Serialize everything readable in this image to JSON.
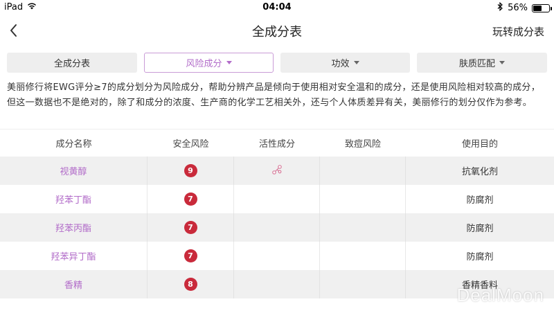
{
  "status_bar": {
    "device": "iPad",
    "time": "04:04",
    "battery": "56%",
    "battery_fraction": 0.56
  },
  "nav": {
    "title": "全成分表",
    "right_link": "玩转成分表"
  },
  "filters": [
    {
      "label": "全成分表",
      "active": false
    },
    {
      "label": "风险成分",
      "active": true
    },
    {
      "label": "功效",
      "active": false
    },
    {
      "label": "肤质匹配",
      "active": false
    }
  ],
  "description": "美丽修行将EWG评分≥7的成分划分为风险成分，帮助分辨产品是倾向于使用相对安全温和的成分，还是使用风险相对较高的成分，但这一数据也不是绝对的，除了和成分的浓度、生产商的化学工艺相关外，还与个人体质差异有关，美丽修行的划分仅作为参考。",
  "table": {
    "headers": [
      "成分名称",
      "安全风险",
      "活性成分",
      "致痘风险",
      "使用目的"
    ],
    "rows": [
      {
        "name": "视黄醇",
        "risk": "9",
        "active_icon": "molecule-icon",
        "acne": "",
        "purpose": "抗氧化剂"
      },
      {
        "name": "羟苯丁酯",
        "risk": "7",
        "active_icon": "",
        "acne": "",
        "purpose": "防腐剂"
      },
      {
        "name": "羟苯丙酯",
        "risk": "7",
        "active_icon": "",
        "acne": "",
        "purpose": "防腐剂"
      },
      {
        "name": "羟苯异丁酯",
        "risk": "7",
        "active_icon": "",
        "acne": "",
        "purpose": "防腐剂"
      },
      {
        "name": "香精",
        "risk": "8",
        "active_icon": "",
        "acne": "",
        "purpose": "香精香料"
      }
    ]
  },
  "watermark": "DealMoon",
  "colors": {
    "accent": "#b26cc9",
    "risk": "#c92a3b",
    "row_alt": "#f0f0f0"
  }
}
